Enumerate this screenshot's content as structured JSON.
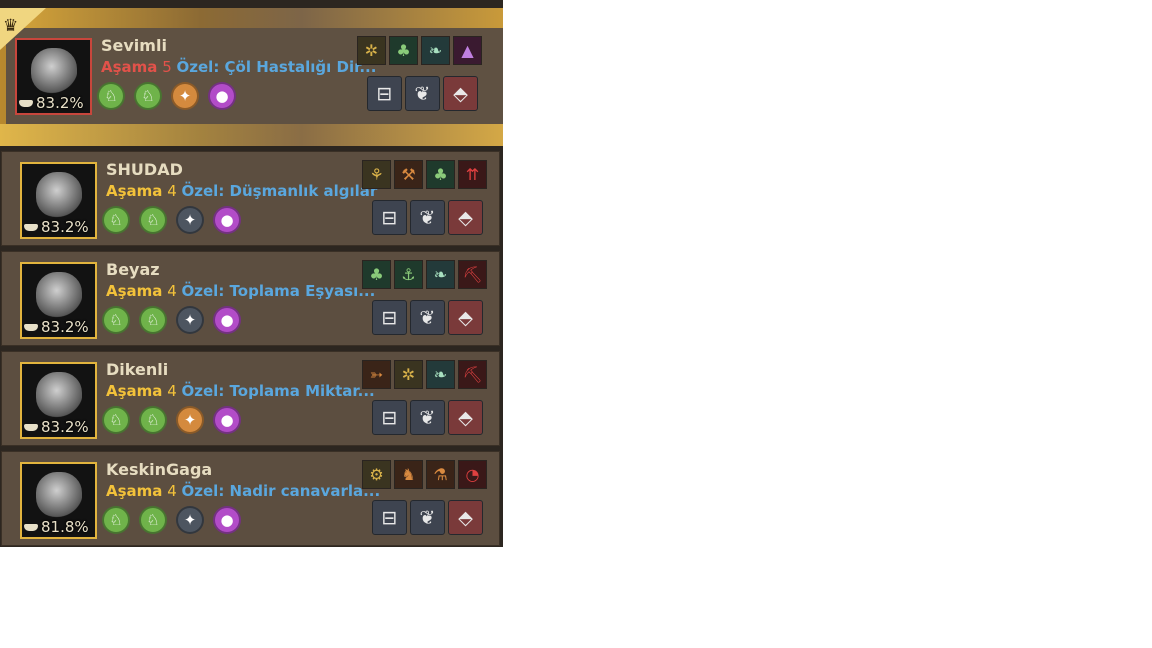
{
  "stage_word": "Aşama",
  "pets": [
    {
      "name": "Sevimli",
      "stage": "5",
      "special": "Özel: Çöl Hastalığı Dir...",
      "hunger": "83.2%",
      "featured": true,
      "circles": [
        "green",
        "green",
        "orange",
        "purple"
      ],
      "skills": [
        {
          "icon": "beetle-icon",
          "s": "a",
          "g": "✲"
        },
        {
          "icon": "clover-icon",
          "s": "b",
          "g": "♣"
        },
        {
          "icon": "wing-icon",
          "s": "c",
          "g": "❧"
        },
        {
          "icon": "potion-icon",
          "s": "d",
          "g": "▲"
        }
      ]
    },
    {
      "name": "SHUDAD",
      "stage": "4",
      "special": "Özel: Düşmanlık algılar",
      "hunger": "83.2%",
      "featured": false,
      "circles": [
        "green",
        "green",
        "gray",
        "purple"
      ],
      "skills": [
        {
          "icon": "wheat-icon",
          "s": "a",
          "g": "⚘"
        },
        {
          "icon": "hammer-icon",
          "s": "e",
          "g": "⚒"
        },
        {
          "icon": "clover-icon",
          "s": "b",
          "g": "♣"
        },
        {
          "icon": "arrows-up-icon",
          "s": "f",
          "g": "⇈"
        }
      ]
    },
    {
      "name": "Beyaz",
      "stage": "4",
      "special": "Özel: Toplama Eşyası...",
      "hunger": "83.2%",
      "featured": false,
      "circles": [
        "green",
        "green",
        "gray",
        "purple"
      ],
      "skills": [
        {
          "icon": "clover-icon",
          "s": "b",
          "g": "♣"
        },
        {
          "icon": "fishing-icon",
          "s": "b",
          "g": "⚓"
        },
        {
          "icon": "wing-icon",
          "s": "c",
          "g": "❧"
        },
        {
          "icon": "pickaxe-icon",
          "s": "f",
          "g": "⛏"
        }
      ]
    },
    {
      "name": "Dikenli",
      "stage": "4",
      "special": "Özel: Toplama Miktar...",
      "hunger": "83.2%",
      "featured": false,
      "circles": [
        "green",
        "green",
        "orange",
        "purple"
      ],
      "skills": [
        {
          "icon": "rifle-icon",
          "s": "e",
          "g": "➳"
        },
        {
          "icon": "beetle-icon",
          "s": "a",
          "g": "✲"
        },
        {
          "icon": "wing-icon",
          "s": "c",
          "g": "❧"
        },
        {
          "icon": "pickaxe-icon",
          "s": "f",
          "g": "⛏"
        }
      ]
    },
    {
      "name": "KeskinGaga",
      "stage": "4",
      "special": "Özel: Nadir canavarla...",
      "hunger": "81.8%",
      "featured": false,
      "circles": [
        "green",
        "green",
        "gray",
        "purple"
      ],
      "skills": [
        {
          "icon": "carriage-icon",
          "s": "a",
          "g": "⚙"
        },
        {
          "icon": "horse-icon",
          "s": "e",
          "g": "♞"
        },
        {
          "icon": "flask-icon",
          "s": "e",
          "g": "⚗"
        },
        {
          "icon": "clock-icon",
          "s": "f",
          "g": "◔"
        }
      ]
    }
  ]
}
